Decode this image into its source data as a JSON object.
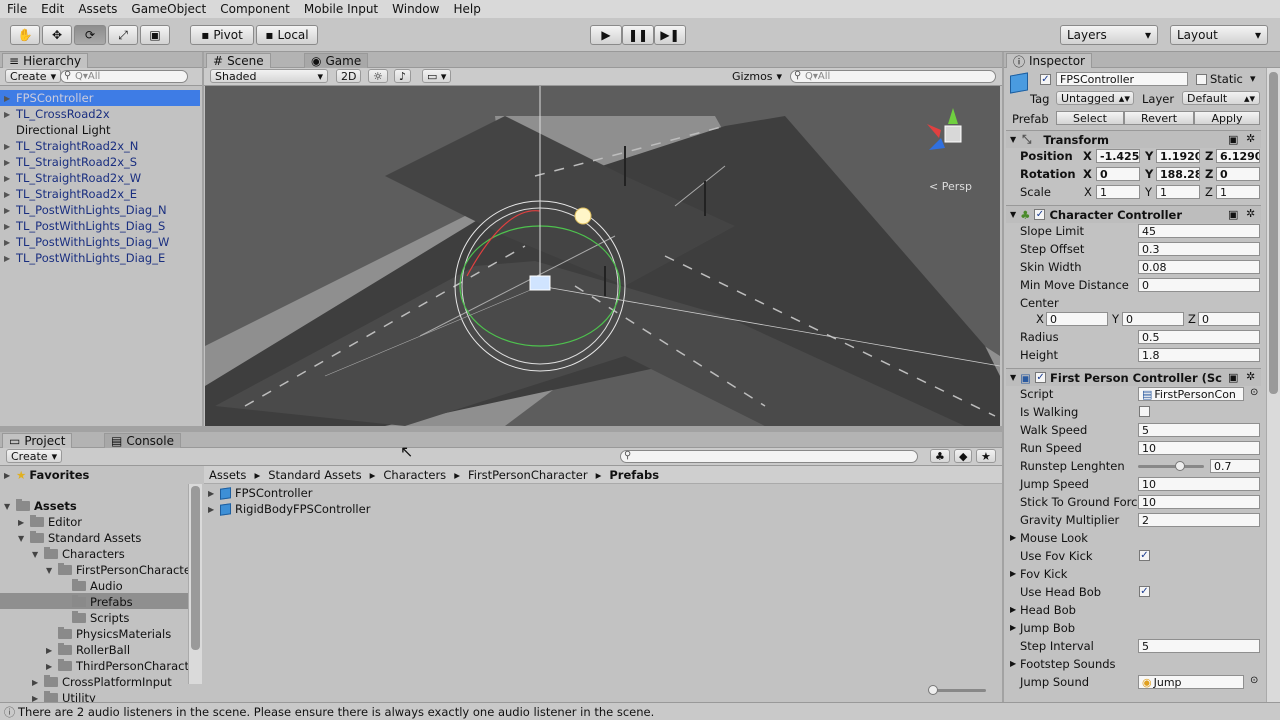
{
  "menu": [
    "File",
    "Edit",
    "Assets",
    "GameObject",
    "Component",
    "Mobile Input",
    "Window",
    "Help"
  ],
  "toolbar": {
    "pivot": "Pivot",
    "local": "Local",
    "layers": "Layers",
    "layout": "Layout"
  },
  "hierarchy": {
    "tab": "Hierarchy",
    "create": "Create",
    "search": "Q▾All",
    "items": [
      "FPSController",
      "TL_CrossRoad2x",
      "Directional Light",
      "TL_StraightRoad2x_N",
      "TL_StraightRoad2x_S",
      "TL_StraightRoad2x_W",
      "TL_StraightRoad2x_E",
      "TL_PostWithLights_Diag_N",
      "TL_PostWithLights_Diag_S",
      "TL_PostWithLights_Diag_W",
      "TL_PostWithLights_Diag_E"
    ]
  },
  "scene": {
    "tab_scene": "Scene",
    "tab_game": "Game",
    "shaded": "Shaded",
    "mode2d": "2D",
    "gizmos": "Gizmos",
    "search": "Q▾All",
    "persp": "Persp"
  },
  "project": {
    "tab_project": "Project",
    "tab_console": "Console",
    "create": "Create",
    "favorites": "Favorites",
    "assets": "Assets",
    "tree": [
      "Editor",
      "Standard Assets",
      "Characters",
      "FirstPersonCharacte",
      "Audio",
      "Prefabs",
      "Scripts",
      "PhysicsMaterials",
      "RollerBall",
      "ThirdPersonCharact",
      "CrossPlatformInput",
      "Utility"
    ],
    "breadcrumb": [
      "Assets",
      "Standard Assets",
      "Characters",
      "FirstPersonCharacter",
      "Prefabs"
    ],
    "files": [
      "FPSController",
      "RigidBodyFPSController"
    ]
  },
  "inspector": {
    "tab": "Inspector",
    "name": "FPSController",
    "static": "Static",
    "tag_label": "Tag",
    "tag": "Untagged",
    "layer_label": "Layer",
    "layer": "Default",
    "prefab": "Prefab",
    "select": "Select",
    "revert": "Revert",
    "apply": "Apply",
    "transform": {
      "title": "Transform",
      "position": "Position",
      "rotation": "Rotation",
      "scale": "Scale",
      "pos": [
        "-1.425",
        "1.1920",
        "6.1290"
      ],
      "rot": [
        "0",
        "188.28",
        "0"
      ],
      "scl": [
        "1",
        "1",
        "1"
      ]
    },
    "cc": {
      "title": "Character Controller",
      "slope_limit": "Slope Limit",
      "slope_limit_v": "45",
      "step_offset": "Step Offset",
      "step_offset_v": "0.3",
      "skin_width": "Skin Width",
      "skin_width_v": "0.08",
      "min_move": "Min Move Distance",
      "min_move_v": "0",
      "center": "Center",
      "center_v": [
        "0",
        "0",
        "0"
      ],
      "radius": "Radius",
      "radius_v": "0.5",
      "height": "Height",
      "height_v": "1.8"
    },
    "fpc": {
      "title": "First Person Controller (Sc",
      "script": "Script",
      "script_v": "FirstPersonCon",
      "is_walking": "Is Walking",
      "walk_speed": "Walk Speed",
      "walk_speed_v": "5",
      "run_speed": "Run Speed",
      "run_speed_v": "10",
      "runstep": "Runstep Lenghten",
      "runstep_v": "0.7",
      "runstep_fraction": 0.7,
      "jump_speed": "Jump Speed",
      "jump_speed_v": "10",
      "stick": "Stick To Ground Forc",
      "stick_v": "10",
      "gravity": "Gravity Multiplier",
      "gravity_v": "2",
      "mouse_look": "Mouse Look",
      "use_fov": "Use Fov Kick",
      "fov_kick": "Fov Kick",
      "use_head_bob": "Use Head Bob",
      "head_bob": "Head Bob",
      "jump_bob": "Jump Bob",
      "step_interval": "Step Interval",
      "step_interval_v": "5",
      "footstep": "Footstep Sounds",
      "jump_sound": "Jump Sound",
      "jump_sound_v": "Jump"
    }
  },
  "status": "There are 2 audio listeners in the scene. Please ensure there is always exactly one audio listener in the scene."
}
